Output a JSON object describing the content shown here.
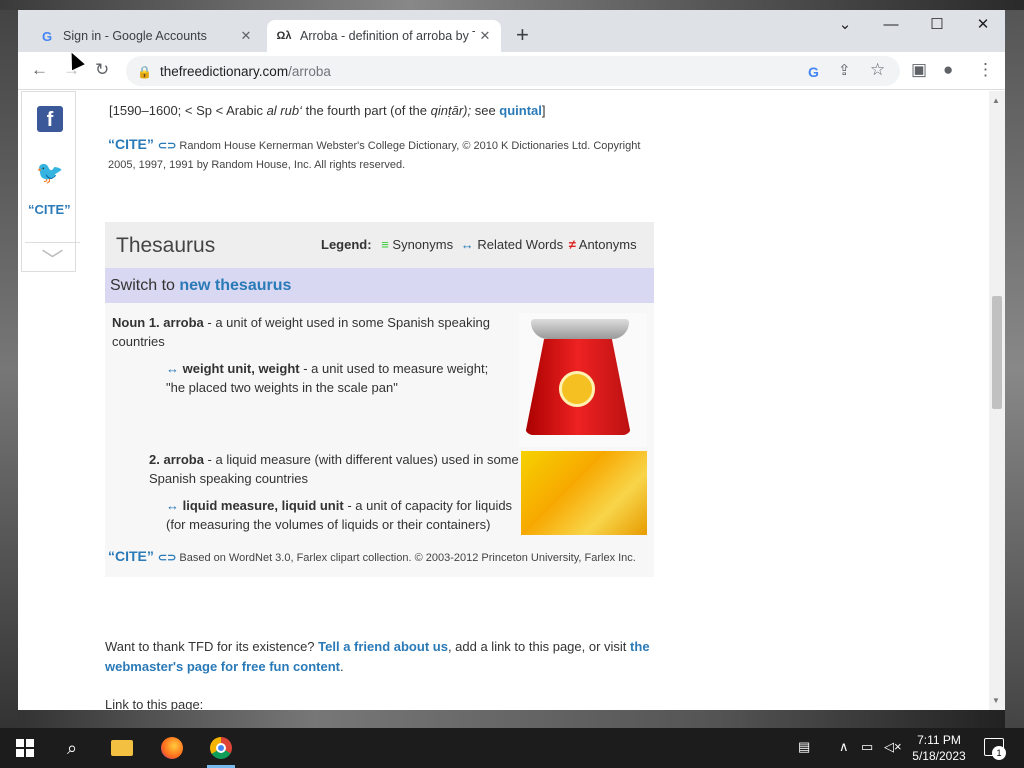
{
  "browser": {
    "tabs": [
      {
        "title": "Sign in - Google Accounts",
        "favicon": "google-g-icon"
      },
      {
        "title": "Arroba - definition of arroba by T",
        "favicon": "tfd-icon"
      }
    ],
    "new_tab": "+",
    "window_controls": {
      "minimize": "—",
      "maximize": "☐",
      "close": "✕",
      "tab_search": "⌄"
    },
    "url_host": "thefreedictionary.com",
    "url_path": "/arroba",
    "icons": [
      "back-icon",
      "forward-icon",
      "reload-icon",
      "lock-icon",
      "google-lens-icon",
      "share-icon",
      "bookmark-star-icon",
      "side-panel-icon",
      "profile-icon",
      "menu-icon"
    ]
  },
  "sidebar": {
    "facebook": "f",
    "cite": "“CITE”"
  },
  "etymology": {
    "prefix": "[1590–1600; < Sp < Arabic ",
    "arabic": "al rub‘",
    "middle": " the fourth part (of the ",
    "qintar": "qinṭār);",
    "see": " see ",
    "see_link": "quintal",
    "suffix": "]"
  },
  "cite_rh": {
    "badge": "“CITE”",
    "text": "Random House Kernerman Webster's College Dictionary, © 2010 K Dictionaries Ltd. Copyright 2005, 1997, 1991 by Random House, Inc. All rights reserved."
  },
  "thesaurus": {
    "title": "Thesaurus",
    "legend_label": "Legend:",
    "legend_synonyms": "Synonyms",
    "legend_related": "Related Words",
    "legend_antonyms": "Antonyms",
    "switch_prefix": "Switch to ",
    "switch_link": "new thesaurus",
    "senses": [
      {
        "label": "Noun 1.",
        "word": "arroba",
        "definition": " - a unit of weight used in some Spanish speaking countries",
        "related": [
          {
            "arrow": "↔",
            "links": "weight unit, weight",
            "gloss": " - a unit used to measure weight; \"he placed two weights in the scale pan\""
          }
        ]
      },
      {
        "label": "2.",
        "word": "arroba",
        "definition": " - a liquid measure (with different values) used in some Spanish speaking countries",
        "related": [
          {
            "arrow": "↔",
            "links": "liquid measure, liquid unit",
            "gloss": " - a unit of capacity for liquids (for measuring the volumes of liquids or their containers)"
          }
        ]
      }
    ],
    "footer_badge": "“CITE”",
    "footer_text": "Based on WordNet 3.0, Farlex clipart collection. © 2003-2012 Princeton University, Farlex Inc."
  },
  "thank": {
    "prefix": "Want to thank TFD for its existence? ",
    "link1": "Tell a friend about us",
    "middle": ", add a link to this page, or visit ",
    "link2": "the webmaster's page for free fun content",
    "suffix": "."
  },
  "link_to_page": "Link to this page:",
  "taskbar": {
    "time": "7:11 PM",
    "date": "5/18/2023",
    "notification_count": "1",
    "apps": [
      "windows-start-icon",
      "search-icon",
      "file-explorer-icon",
      "firefox-icon",
      "chrome-icon"
    ]
  }
}
